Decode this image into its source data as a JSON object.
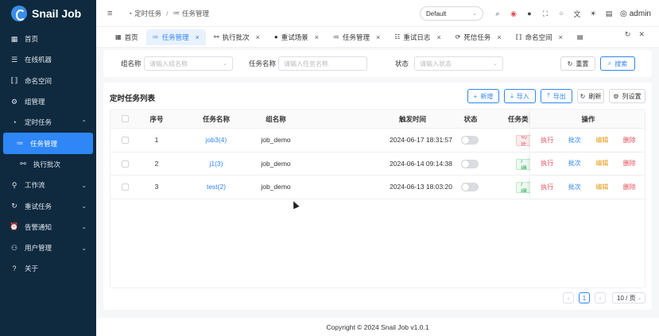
{
  "app": {
    "name": "Snail Job"
  },
  "sidebar": {
    "items": [
      {
        "label": "首页",
        "icon": "grid-icon",
        "glyph": "▦"
      },
      {
        "label": "在线机器",
        "icon": "list-icon",
        "glyph": "☰"
      },
      {
        "label": "命名空间",
        "icon": "brackets-icon",
        "glyph": "⟦⟧"
      },
      {
        "label": "组管理",
        "icon": "cog-icon",
        "glyph": "⚙"
      },
      {
        "label": "定时任务",
        "icon": "timer-icon",
        "glyph": "◔",
        "expanded": true
      },
      {
        "label": "任务管理",
        "icon": "tasks-icon",
        "glyph": "≔",
        "active": true
      },
      {
        "label": "执行批次",
        "icon": "batch-icon",
        "glyph": "⚯"
      },
      {
        "label": "工作流",
        "icon": "workflow-icon",
        "glyph": "⚲"
      },
      {
        "label": "重试任务",
        "icon": "retry-icon",
        "glyph": "↻"
      },
      {
        "label": "告警通知",
        "icon": "alarm-icon",
        "glyph": "⏰"
      },
      {
        "label": "用户管理",
        "icon": "users-icon",
        "glyph": "⚇"
      },
      {
        "label": "关于",
        "icon": "about-icon",
        "glyph": "?"
      }
    ]
  },
  "header": {
    "breadcrumb": [
      "定时任务",
      "任务管理"
    ],
    "namespace": "Default",
    "user": "admin"
  },
  "tabs": [
    {
      "label": "首页",
      "icon": "grid-icon",
      "glyph": "▦",
      "closable": false
    },
    {
      "label": "任务管理",
      "icon": "tasks-icon",
      "glyph": "≔",
      "active": true
    },
    {
      "label": "执行批次",
      "icon": "batch-icon",
      "glyph": "⚯"
    },
    {
      "label": "重试场景",
      "icon": "scene-icon",
      "glyph": "●"
    },
    {
      "label": "任务管理",
      "icon": "tasks-icon",
      "glyph": "≔"
    },
    {
      "label": "重试日志",
      "icon": "log-icon",
      "glyph": "☷"
    },
    {
      "label": "死信任务",
      "icon": "dead-icon",
      "glyph": "⟳"
    },
    {
      "label": "命名空间",
      "icon": "brackets-icon",
      "glyph": "⟦⟧"
    },
    {
      "label": "",
      "icon": "doc-icon",
      "glyph": "▤"
    }
  ],
  "search": {
    "group_label": "组名称",
    "group_placeholder": "请输入组名称",
    "task_label": "任务名称",
    "task_placeholder": "请输入任务名称",
    "status_label": "状态",
    "status_placeholder": "请输入状态",
    "reset": "重置",
    "search": "搜索"
  },
  "table": {
    "title": "定时任务列表",
    "buttons": {
      "add": "新增",
      "import": "导入",
      "export": "导出",
      "refresh": "刷新",
      "columns": "列设置"
    },
    "headers": {
      "index": "序号",
      "name": "任务名称",
      "group": "组名称",
      "trigger": "触发时间",
      "status": "状态",
      "type": "任务类",
      "ops": "操作"
    },
    "rows": [
      {
        "index": "1",
        "name": "job3(4)",
        "group": "job_demo",
        "trigger": "2024-06-17 18:31:57",
        "type": "切片",
        "type_color": "red"
      },
      {
        "index": "2",
        "name": "j1(3)",
        "group": "job_demo",
        "trigger": "2024-06-14 09:14:38",
        "type": "广播",
        "type_color": "green"
      },
      {
        "index": "3",
        "name": "test(2)",
        "group": "job_demo",
        "trigger": "2024-06-13 18:03:20",
        "type": "广播",
        "type_color": "green"
      }
    ],
    "ops": {
      "exec": "执行",
      "batch": "批次",
      "edit": "编辑",
      "delete": "删除"
    }
  },
  "pager": {
    "current": "1",
    "size": "10 / 页"
  },
  "footer": {
    "copyright": "Copyright © 2024 Snail Job v1.0.1"
  },
  "colors": {
    "primary": "#2f86f6",
    "sidebar": "#0f2a3f",
    "danger": "#e34d59",
    "warning": "#e69a12",
    "success": "#36b15a"
  }
}
